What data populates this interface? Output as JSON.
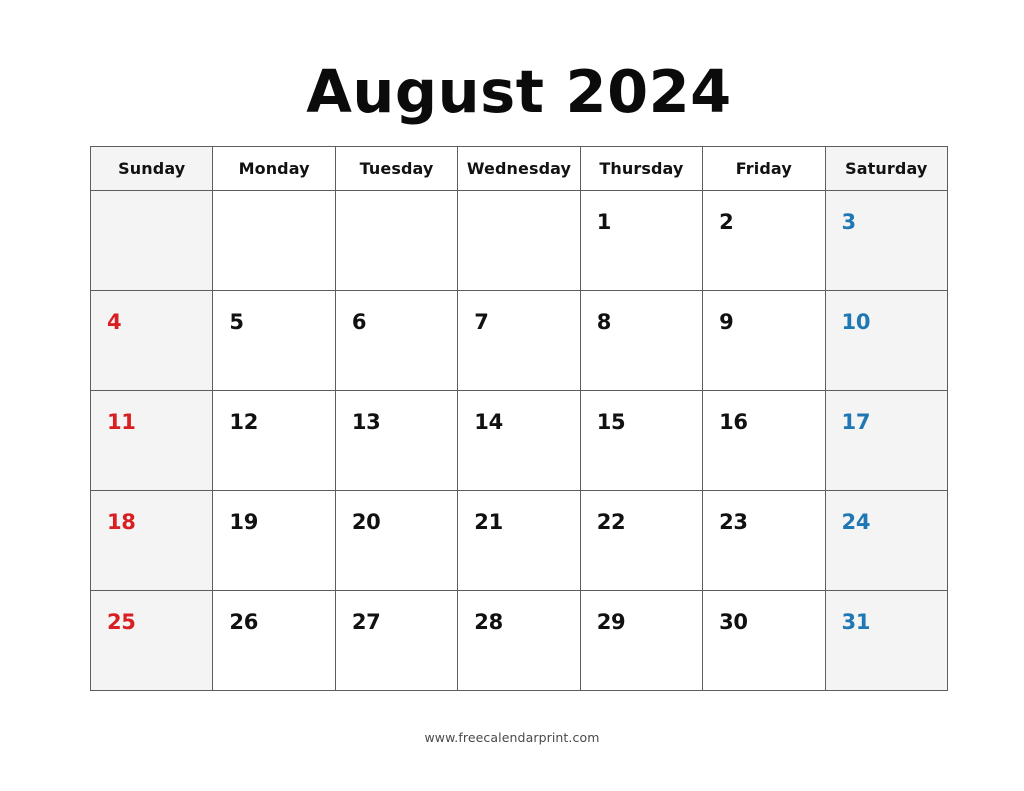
{
  "calendar": {
    "title": "August 2024",
    "month": "August",
    "year": "2024",
    "weekday_headers": [
      "Sunday",
      "Monday",
      "Tuesday",
      "Wednesday",
      "Thursday",
      "Friday",
      "Saturday"
    ],
    "weeks": [
      [
        "",
        "",
        "",
        "",
        "1",
        "2",
        "3"
      ],
      [
        "4",
        "5",
        "6",
        "7",
        "8",
        "9",
        "10"
      ],
      [
        "11",
        "12",
        "13",
        "14",
        "15",
        "16",
        "17"
      ],
      [
        "18",
        "19",
        "20",
        "21",
        "22",
        "23",
        "24"
      ],
      [
        "25",
        "26",
        "27",
        "28",
        "29",
        "30",
        "31"
      ]
    ],
    "colors": {
      "sunday_text": "#d81f21",
      "saturday_text": "#1f77b4",
      "weekday_text": "#111111",
      "weekend_cell_background": "#f4f4f4",
      "cell_background": "#ffffff",
      "grid_border": "#5d5d5d",
      "title_text": "#0b0b0b",
      "footer_text": "#4a4a4a"
    }
  },
  "footer": {
    "website": "www.freecalendarprint.com"
  }
}
